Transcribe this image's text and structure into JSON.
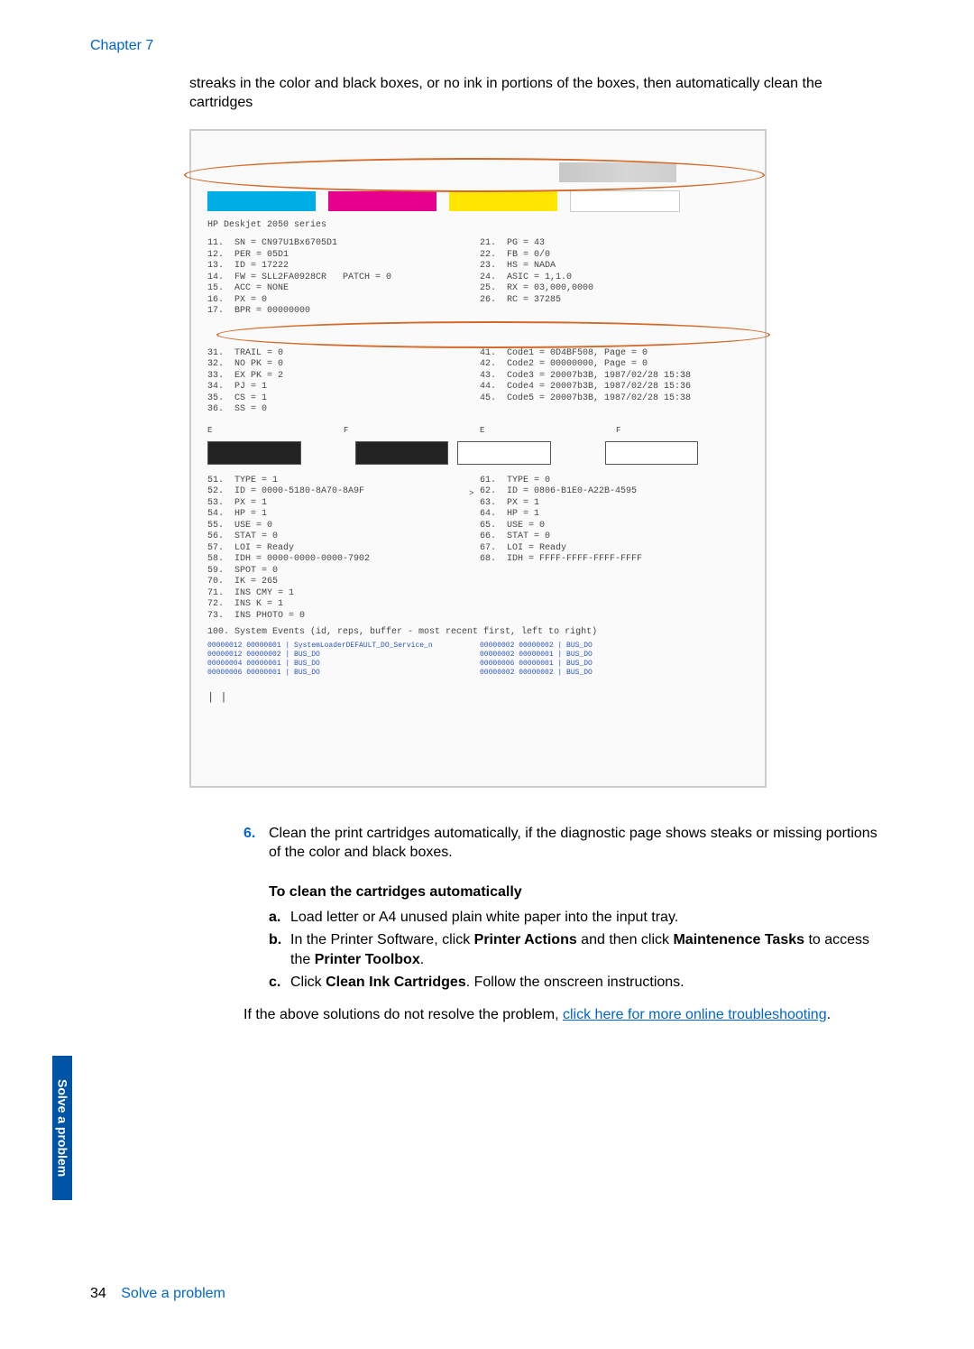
{
  "chapter": "Chapter 7",
  "intro": "streaks in the color and black boxes, or no ink in portions of the boxes, then automatically clean the cartridges",
  "diag": {
    "title": "HP Deskjet 2050 series",
    "left1": "11.  SN = CN97U1Bx6705D1\n12.  PER = 05D1\n13.  ID = 17222\n14.  FW = SLL2FA0928CR   PATCH = 0\n15.  ACC = NONE\n16.  PX = 0\n17.  BPR = 00000000",
    "right1": "21.  PG = 43\n22.  FB = 0/0\n23.  HS = NADA\n24.  ASIC = 1,1.0\n25.  RX = 03,000,0000\n26.  RC = 37285",
    "left2": "31.  TRAIL = 0\n32.  NO PK = 0\n33.  EX PK = 2\n34.  PJ = 1\n35.  CS = 1\n36.  SS = 0",
    "right2": "41.  Code1 = 0D4BF508, Page = 0\n42.  Code2 = 00000000, Page = 0\n43.  Code3 = 20007b3B, 1987/02/28 15:38\n44.  Code4 = 20007b3B, 1987/02/28 15:36\n45.  Code5 = 20007b3B, 1987/02/28 15:38",
    "ef_labels": [
      "E",
      "F",
      "E",
      "F"
    ],
    "left3": "51.  TYPE = 1\n52.  ID = 0000-5180-8A70-8A9F\n53.  PX = 1\n54.  HP = 1\n55.  USE = 0\n56.  STAT = 0\n57.  LOI = Ready\n58.  IDH = 0000-0000-0000-7902\n59.  SPOT = 0\n70.  IK = 265\n71.  INS CMY = 1\n72.  INS K = 1\n73.  INS PHOTO = 0",
    "right3": "61.  TYPE = 0\n62.  ID = 0806-B1E0-A22B-4595\n63.  PX = 1\n64.  HP = 1\n65.  USE = 0\n66.  STAT = 0\n67.  LOI = Ready\n68.  IDH = FFFF-FFFF-FFFF-FFFF",
    "dot": ">",
    "sys_hdr": "100. System Events (id, reps, buffer - most recent first, left to right)",
    "sys_l": "00000012 00000001 | SystemLoaderDEFAULT_DO_Service_n\n00000012 00000002 | BUS_DO\n00000004 00000001 | BUS_DO\n00000006 00000001 | BUS_DO",
    "sys_r": "00000002 00000002 | BUS_DO\n00000002 00000001 | BUS_DO\n00000006 00000001 | BUS_DO\n00000002 00000002 | BUS_DO",
    "br": "| |"
  },
  "step6": {
    "num": "6.",
    "text": "Clean the print cartridges automatically, if the diagnostic page shows steaks or missing portions of the color and black boxes."
  },
  "sub_heading": "To clean the cartridges automatically",
  "sub": {
    "a_l": "a",
    "a_t": "Load letter or A4 unused plain white paper into the input tray.",
    "b_l": "b",
    "b_t_1": "In the Printer Software, click ",
    "b_t_2": "Printer Actions",
    "b_t_3": " and then click ",
    "b_t_4": "Maintenence Tasks",
    "b_t_5": " to access the ",
    "b_t_6": "Printer Toolbox",
    "b_t_7": ".",
    "c_l": "c",
    "c_t_1": "Click ",
    "c_t_2": "Clean Ink Cartridges",
    "c_t_3": ". Follow the onscreen instructions."
  },
  "closing_1": "If the above solutions do not resolve the problem, ",
  "closing_link": "click here for more online troubleshooting",
  "closing_2": ".",
  "side_tab": "Solve a problem",
  "page_number": "34",
  "footer_section": "Solve a problem"
}
